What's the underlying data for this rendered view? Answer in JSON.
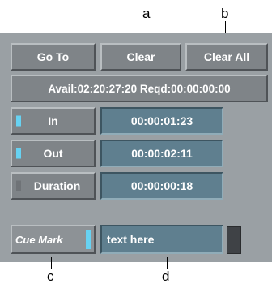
{
  "callouts": {
    "a": "a",
    "b": "b",
    "c": "c",
    "d": "d"
  },
  "buttons": {
    "go_to": "Go To",
    "clear": "Clear",
    "clear_all": "Clear All"
  },
  "status": {
    "text": "Avail:02:20:27:20 Reqd:00:00:00:00"
  },
  "rows": {
    "in": {
      "label": "In",
      "value": "00:00:01:23",
      "indicator_on": true
    },
    "out": {
      "label": "Out",
      "value": "00:00:02:11",
      "indicator_on": true
    },
    "duration": {
      "label": "Duration",
      "value": "00:00:00:18",
      "indicator_on": false
    }
  },
  "cue_mark": {
    "label": "Cue Mark",
    "text_value": "text here",
    "indicator_on": true
  },
  "colors": {
    "panel": "#9aa0a4",
    "button": "#7f8488",
    "field": "#5f7f8f",
    "indicator_on": "#67d2f2",
    "indicator_off": "#6f7377"
  }
}
